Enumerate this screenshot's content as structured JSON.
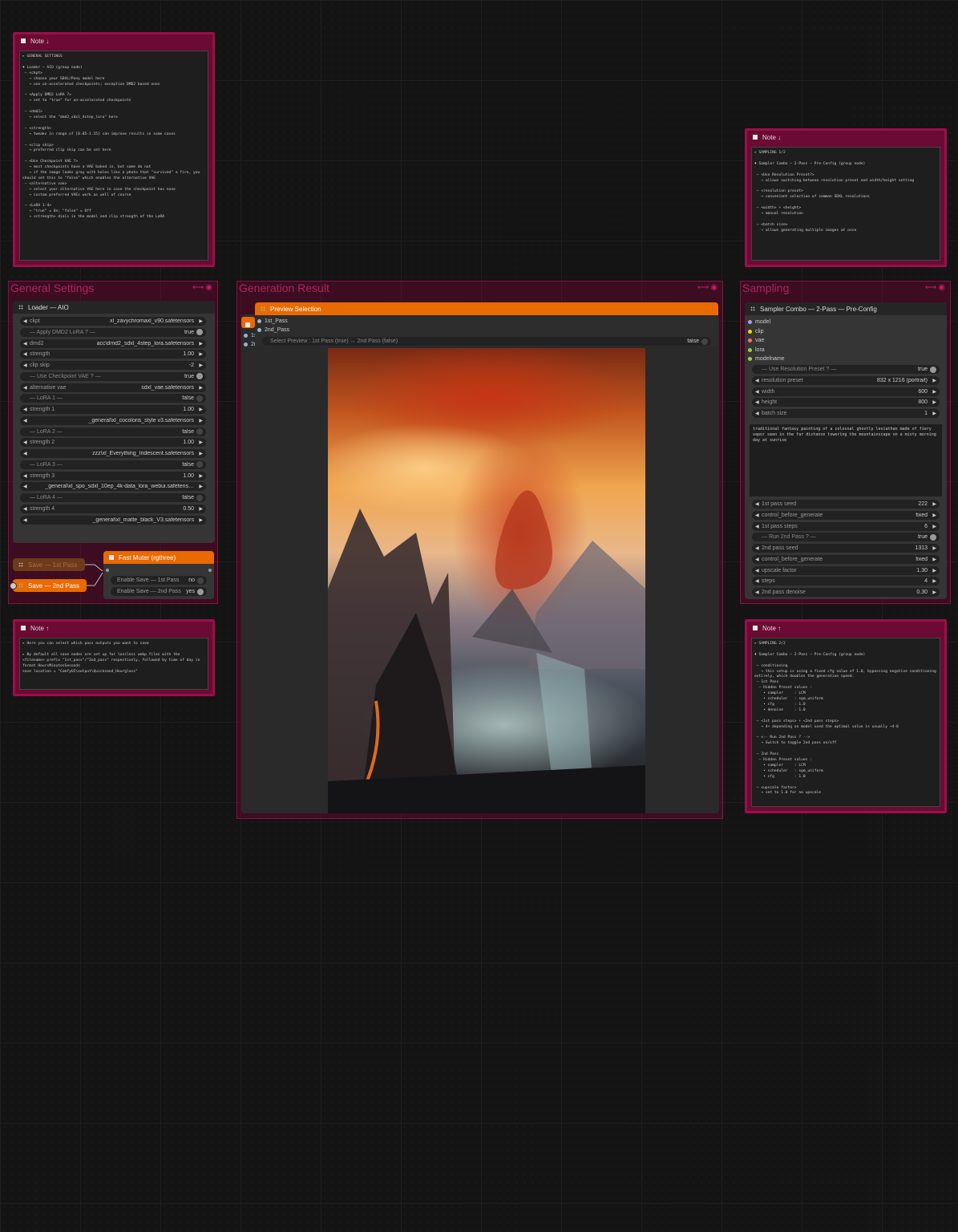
{
  "notes": {
    "general": {
      "title": "Note ↓",
      "body": "▸ GENERAL SETTINGS\n\n♦ Loader — AIO (group node)\n — <ckpt>\n   → choose your SDXL/Pony model here\n   → use un-accelerated checkpoints; exception DMD2 based ones\n\n — <Apply DMD2 LoRA ?>\n   → set to \"true\" for un-accelerated checkpoints\n\n — <dmd2>\n   → select the \"dmd2_sdxl_4step_lora\" here\n\n — <strength>\n   → tweaks in range of [0.85-1.15] can improve results in some cases\n\n — <clip skip>\n   → preferred clip skip can be set here\n\n — <Use Checkpoint VAE ?>\n   → most checkpoints have a VAE baked in, but some do not\n   → if the image looks gray with holes like a photo that \"survived\" a fire, you\nshould set this to \"false\" which enables the alternative VAE\n — <alternative vae>\n   → select your alternative VAE here in case the checkpoint has none\n   → custom preferred VAEs work as well of course\n\n — <LoRA 1-4>\n   → \"true\" = On; \"false\" = Off\n   → <strength> dials in the model and clip strength of the LoRA"
    },
    "sampling1": {
      "title": "Note ↓",
      "body": "▸ SAMPLING 1/2\n\n♦ Sampler Combo — 2-Pass — Pre-Config (group node)\n\n — <Use Resolution Preset?>\n   → allows switching between resolution preset and width/height setting\n\n — <resolution preset>\n   → convenient selection of common SDXL resolutions\n\n — <width> + <height>\n   → manual resolution\n\n — <batch size>\n   → allows generating multiple images at once"
    },
    "save": {
      "title": "Note ↑",
      "body": "▸ Here you can select which pass outputs you want to save\n\n▸ By default all save nodes are set up for lossless webp files with the\n<filename> prefix \"1st_pass\"/\"2nd_pass\" respectively, followed by time of day in\nformat HoursMinutesSeconds\nsave location = \"ComfyUI\\output\\Quicksand_Hourglass\""
    },
    "sampling2": {
      "title": "Note ↑",
      "body": "▸ SAMPLING 2/2\n\n♦ Sampler Combo — 2-Pass — Pre-Config (group node)\n\n — conditioning\n   → this setup is using a fixed cfg value of 1.0, bypassing negative conditioning\nentirely, which doubles the generation speed.\n — 1st Pass\n  — Hidden Preset values :\n    • sampler     : LCM\n    • scheduler   : sgm_uniform\n    • cfg         : 1.0\n    • denoise     : 1.0\n\n — <1st pass steps> + <2nd pass steps>\n   → 4+ depending on model used the optimal value is usually ~4-8\n\n — <-- Run 2nd Pass ? -->\n   → Switch to toggle 2nd pass on/off\n\n — 2nd Pass\n  — Hidden Preset values :\n    • sampler     : LCM\n    • scheduler   : sgm_uniform\n    • cfg         : 1.0\n\n — <upscale factor>\n   → set to 1.0 for no upscale"
    }
  },
  "groups": {
    "general": "General Settings",
    "result": "Generation Result",
    "sampling": "Sampling"
  },
  "loader": {
    "title": "Loader — AIO",
    "widgets": [
      {
        "label": "ckpt",
        "value": "xl_zavychromaxl_v90.safetensors",
        "kind": "combo"
      },
      {
        "label": "— Apply DMD2 LoRA ? —",
        "value": "true",
        "kind": "toggle",
        "on": true
      },
      {
        "label": "dmd2",
        "value": "acc\\dmd2_sdxl_4step_lora.safetensors",
        "kind": "combo"
      },
      {
        "label": "strength",
        "value": "1.00",
        "kind": "number"
      },
      {
        "label": "clip skip",
        "value": "-2",
        "kind": "number"
      },
      {
        "label": "— Use Checkpoint VAE ? —",
        "value": "true",
        "kind": "toggle",
        "on": true
      },
      {
        "label": "alternative vae",
        "value": "sdxl_vae.safetensors",
        "kind": "combo"
      },
      {
        "label": "— LoRA 1 —",
        "value": "false",
        "kind": "toggle",
        "on": false
      },
      {
        "label": "strength 1",
        "value": "1.00",
        "kind": "number"
      },
      {
        "label": "",
        "value": "_general\\xl_cocoloris_style v3.safetensors",
        "kind": "combo"
      },
      {
        "label": "— LoRA 2 —",
        "value": "false",
        "kind": "toggle",
        "on": false
      },
      {
        "label": "strength 2",
        "value": "1.00",
        "kind": "number"
      },
      {
        "label": "",
        "value": "zzz\\xl_Everything_Iridescent.safetensors",
        "kind": "combo"
      },
      {
        "label": "— LoRA 3 —",
        "value": "false",
        "kind": "toggle",
        "on": false
      },
      {
        "label": "strength 3",
        "value": "1.00",
        "kind": "number"
      },
      {
        "label": "",
        "value": "_general\\xl_spo_sdxl_10ep_4k-data_lora_webui.safetens…",
        "kind": "combo"
      },
      {
        "label": "— LoRA 4 —",
        "value": "false",
        "kind": "toggle",
        "on": false
      },
      {
        "label": "strength 4",
        "value": "0.50",
        "kind": "number"
      },
      {
        "label": "",
        "value": "_general\\xl_matte_black_V3.safetensors",
        "kind": "combo"
      }
    ]
  },
  "save1": "Save — 1st Pass",
  "save2": "Save — 2nd Pass",
  "muter": {
    "title": "Fast Muter (rgthree)",
    "w1_label": "Enable Save — 1st Pass",
    "w1_value": "no",
    "w2_label": "Enable Save — 2nd Pass",
    "w2_value": "yes"
  },
  "preview": {
    "title": "Preview Selection",
    "in1": "1st_Pass",
    "in2": "2nd_Pass",
    "stub1": "1s",
    "stub2": "2n",
    "select_label": "Select Preview : 1st Pass (true) ↔ 2nd Pass (false)",
    "select_value": "false"
  },
  "sampler": {
    "title": "Sampler Combo — 2-Pass — Pre-Config",
    "inputs": [
      {
        "name": "model",
        "color": "#b39ddb"
      },
      {
        "name": "clip",
        "color": "#ffd500"
      },
      {
        "name": "vae",
        "color": "#ff6e6e"
      },
      {
        "name": "lora",
        "color": "#9bd23c"
      },
      {
        "name": "modelname",
        "color": "#9bd23c"
      }
    ],
    "widgets_a": [
      {
        "label": "— Use Resolution Preset ? —",
        "value": "true",
        "kind": "toggle",
        "on": true
      },
      {
        "label": "resolution preset",
        "value": "832 x 1216  (portrait)",
        "kind": "combo"
      },
      {
        "label": "width",
        "value": "600",
        "kind": "number"
      },
      {
        "label": "height",
        "value": "800",
        "kind": "number"
      },
      {
        "label": "batch size",
        "value": "1",
        "kind": "number"
      }
    ],
    "prompt": "traditional fantasy painting of a colossal ghostly leviathan made of fiery vapor seen in the far distance towering the mountainscape on a misty morning day at sunrise",
    "widgets_b": [
      {
        "label": "1st pass seed",
        "value": "222",
        "kind": "number"
      },
      {
        "label": "control_before_generate",
        "value": "fixed",
        "kind": "combo"
      },
      {
        "label": "1st pass steps",
        "value": "6",
        "kind": "number"
      },
      {
        "label": "— Run 2nd Pass ? —",
        "value": "true",
        "kind": "toggle",
        "on": true
      },
      {
        "label": "2nd pass seed",
        "value": "1313",
        "kind": "number"
      },
      {
        "label": "control_before_generate",
        "value": "fixed",
        "kind": "combo"
      },
      {
        "label": "upscale factor",
        "value": "1.30",
        "kind": "number"
      },
      {
        "label": "steps",
        "value": "4",
        "kind": "number"
      },
      {
        "label": "2nd pass denoise",
        "value": "0.30",
        "kind": "number"
      }
    ]
  }
}
